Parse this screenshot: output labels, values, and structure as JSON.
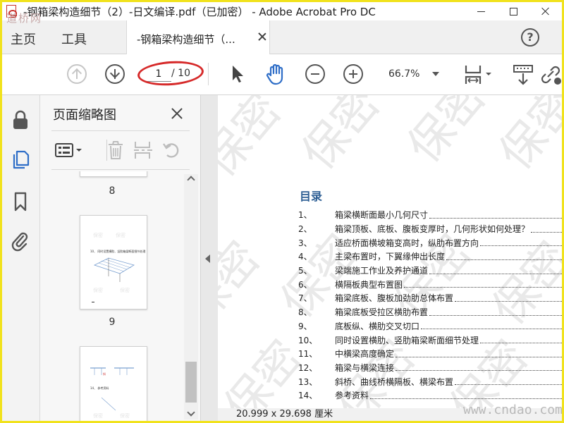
{
  "window": {
    "title": "-钢箱梁构造细节（2）-日文编译.pdf（已加密） - Adobe Acrobat Pro DC"
  },
  "nav": {
    "home": "主页",
    "tools": "工具",
    "tab_label": "-钢箱梁构造细节（...",
    "help": "?"
  },
  "toolbar": {
    "current_page": "1",
    "total_pages": "/ 10",
    "zoom": "66.7%"
  },
  "thumbnails": {
    "title": "页面缩略图",
    "pages": [
      {
        "number": "8"
      },
      {
        "number": "9"
      }
    ]
  },
  "document": {
    "toc_title": "目录",
    "toc": [
      {
        "num": "1、",
        "text": "箱梁横断面最小几何尺寸"
      },
      {
        "num": "2、",
        "text": "箱梁顶板、底板、腹板变厚时，几何形状如何处理？"
      },
      {
        "num": "3、",
        "text": "适应桥面横坡箱变高时，纵肋布置方向"
      },
      {
        "num": "4、",
        "text": "主梁布置时，下翼缘伸出长度"
      },
      {
        "num": "5、",
        "text": "梁端施工作业及养护通道"
      },
      {
        "num": "6、",
        "text": "横隔板典型布置图"
      },
      {
        "num": "7、",
        "text": "箱梁底板、腹板加劲肋总体布置"
      },
      {
        "num": "8、",
        "text": "箱梁底板受拉区横肋布置"
      },
      {
        "num": "9、",
        "text": "底板纵、横肋交叉切口"
      },
      {
        "num": "10、",
        "text": "同时设置横肋、竖肋箱梁断面细节处理"
      },
      {
        "num": "11、",
        "text": "中横梁高度确定"
      },
      {
        "num": "12、",
        "text": "箱梁与横梁连接"
      },
      {
        "num": "13、",
        "text": "斜桥、曲线桥横隔板、横梁布置"
      },
      {
        "num": "14、",
        "text": "参考资料"
      }
    ],
    "page_size": "20.999 x 29.698 厘米"
  },
  "watermarks": {
    "site_top": "道桥网",
    "site_bottom": "www.cndao.com",
    "secret": "保密"
  },
  "colors": {
    "frame": "#f1e21c",
    "accent_blue": "#2f6ec7",
    "toc_title": "#2e5f94",
    "annotation_red": "#d62a2a"
  }
}
